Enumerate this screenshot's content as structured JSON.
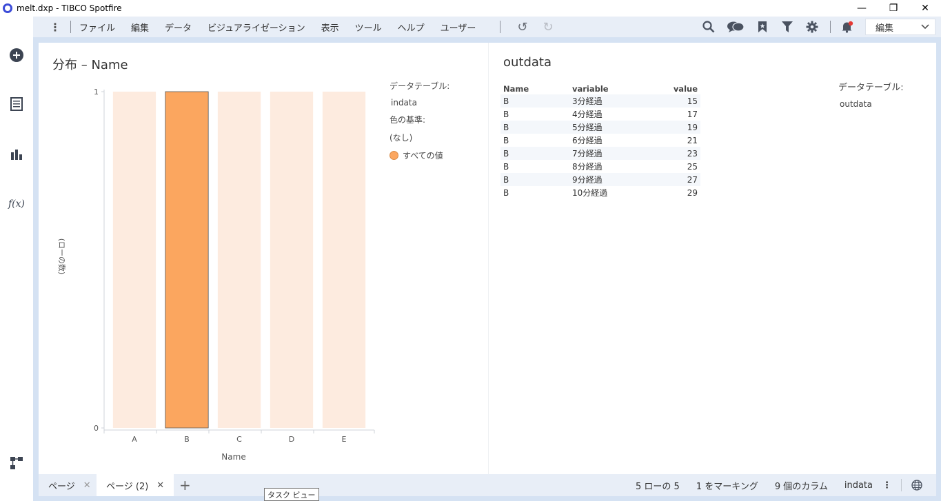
{
  "window": {
    "title": "melt.dxp - TIBCO Spotfire"
  },
  "menu": [
    "ファイル",
    "編集",
    "データ",
    "ビジュアライゼーション",
    "表示",
    "ツール",
    "ヘルプ",
    "ユーザー"
  ],
  "toolbar": {
    "mode": "編集"
  },
  "left_viz": {
    "title": "分布 – Name",
    "legend_table_label": "データテーブル:",
    "legend_table_value": "indata",
    "legend_color_label": "色の基準:",
    "legend_color_value": "(なし)",
    "legend_item": "すべての値"
  },
  "chart_data": {
    "type": "bar",
    "categories": [
      "A",
      "B",
      "C",
      "D",
      "E"
    ],
    "values": [
      1,
      1,
      1,
      1,
      1
    ],
    "marked": [
      false,
      true,
      false,
      false,
      false
    ],
    "xlabel": "Name",
    "ylabel": "(ローの数)",
    "ylim": [
      0,
      1
    ],
    "yticks": [
      "0",
      "1"
    ],
    "bar_color": "#fba65f",
    "bar_color_unmarked": "#fdebdf",
    "grid": false
  },
  "right_viz": {
    "title": "outdata",
    "legend_table_label": "データテーブル:",
    "legend_table_value": "outdata",
    "columns": [
      "Name",
      "variable",
      "value"
    ],
    "rows": [
      [
        "B",
        "3分経過",
        "15"
      ],
      [
        "B",
        "4分経過",
        "17"
      ],
      [
        "B",
        "5分経過",
        "19"
      ],
      [
        "B",
        "6分経過",
        "21"
      ],
      [
        "B",
        "7分経過",
        "23"
      ],
      [
        "B",
        "8分経過",
        "25"
      ],
      [
        "B",
        "9分経過",
        "27"
      ],
      [
        "B",
        "10分経過",
        "29"
      ]
    ]
  },
  "pages": [
    {
      "label": "ページ",
      "active": false
    },
    {
      "label": "ページ (2)",
      "active": true
    }
  ],
  "status": {
    "rows": "5 ローの 5",
    "marked": "1 をマーキング",
    "columns": "9 個のカラム",
    "table": "indata"
  },
  "tooltip": "タスク ビュー"
}
